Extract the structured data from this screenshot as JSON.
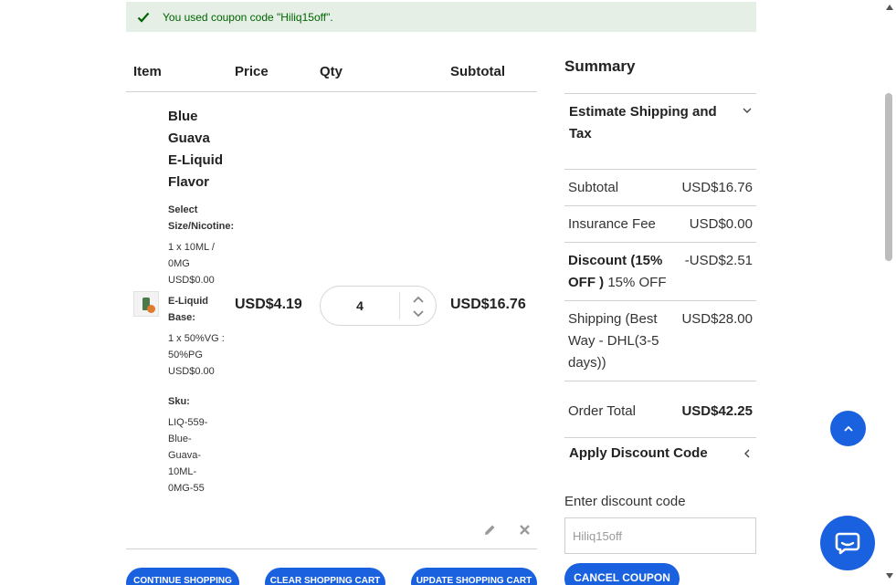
{
  "notice": {
    "message": "You used coupon code \"Hiliq15off\"."
  },
  "cart": {
    "headers": {
      "item": "Item",
      "price": "Price",
      "qty": "Qty",
      "subtotal": "Subtotal"
    },
    "item": {
      "name_lines": [
        "Blue",
        "Guava",
        "E-Liquid",
        "Flavor"
      ],
      "options": [
        {
          "label_lines": [
            "Select",
            "Size/Nicotine:"
          ],
          "value_lines": [
            "1 x 10ML /",
            "0MG",
            "USD$0.00"
          ]
        },
        {
          "label_lines": [
            "E-Liquid",
            "Base:"
          ],
          "value_lines": [
            "1 x 50%VG :",
            "50%PG",
            "USD$0.00"
          ]
        },
        {
          "label_lines": [
            "Sku:"
          ],
          "value_lines": [
            "LIQ-559-",
            "Blue-",
            "Guava-",
            "10ML-",
            "0MG-55"
          ]
        }
      ],
      "price": "USD$4.19",
      "qty": "4",
      "subtotal": "USD$16.76"
    },
    "buttons": {
      "continue": "Continue Shopping",
      "clear": "Clear Shopping Cart",
      "update": "Update Shopping Cart"
    }
  },
  "summary": {
    "title": "Summary",
    "estimate_title": "Estimate Shipping and Tax",
    "rows": {
      "subtotal": {
        "label": "Subtotal",
        "value": "USD$16.76"
      },
      "insurance": {
        "label": "Insurance Fee",
        "value": "USD$0.00"
      },
      "discount": {
        "label_bold": "Discount (15% OFF )",
        "label_rest": " 15% OFF",
        "value": "-USD$2.51"
      },
      "shipping": {
        "label": "Shipping (Best Way - DHL(3-5 days))",
        "value": "USD$28.00"
      },
      "order_total": {
        "label": "Order Total",
        "value": "USD$42.25"
      }
    },
    "discount_section": {
      "title": "Apply Discount Code",
      "input_label": "Enter discount code",
      "input_value": "Hiliq15off",
      "cancel_button": "Cancel Coupon"
    }
  },
  "colors": {
    "accent": "#1a61e0",
    "success_bg": "#e5efe5",
    "success_text": "#006400"
  }
}
